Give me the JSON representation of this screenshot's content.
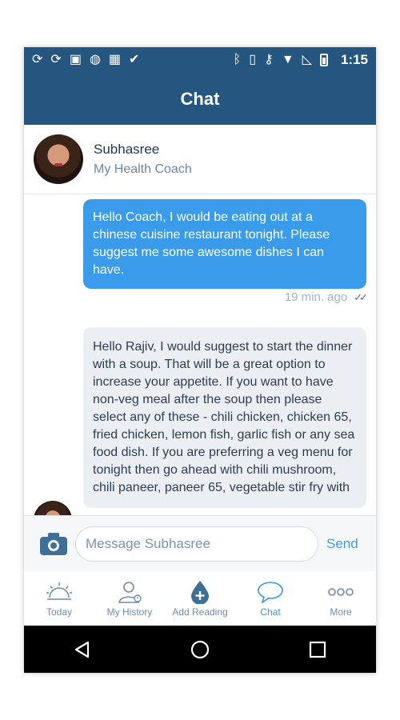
{
  "status_bar": {
    "time": "1:15"
  },
  "app_bar": {
    "title": "Chat"
  },
  "coach": {
    "name": "Subhasree",
    "role": "My Health Coach"
  },
  "messages": [
    {
      "direction": "outgoing",
      "text": "Hello Coach, I would be eating out at a chinese cuisine restaurant tonight. Please suggest me some awesome dishes I can have.",
      "time": "19 min. ago"
    },
    {
      "direction": "incoming",
      "text": "Hello Rajiv, I would suggest to start the dinner with a soup. That will be a great option to increase your appetite. If you want to have non-veg meal after the soup then please select any of these -  chili chicken, chicken 65, fried chicken, lemon fish, garlic fish or any sea food dish. If you are preferring a veg menu for tonight then go ahead with chili mushroom, chili paneer, paneer 65, vegetable stir fry with"
    }
  ],
  "composer": {
    "placeholder": "Message Subhasree",
    "send_label": "Send"
  },
  "tabs": [
    {
      "label": "Today",
      "icon": "sunrise-icon"
    },
    {
      "label": "My History",
      "icon": "person-history-icon"
    },
    {
      "label": "Add Reading",
      "icon": "drop-plus-icon"
    },
    {
      "label": "Chat",
      "icon": "chat-bubble-icon",
      "active": true
    },
    {
      "label": "More",
      "icon": "more-dots-icon"
    }
  ],
  "colors": {
    "brand": "#255680",
    "accent": "#3a9bea",
    "incoming_bubble": "#ebeef2"
  }
}
